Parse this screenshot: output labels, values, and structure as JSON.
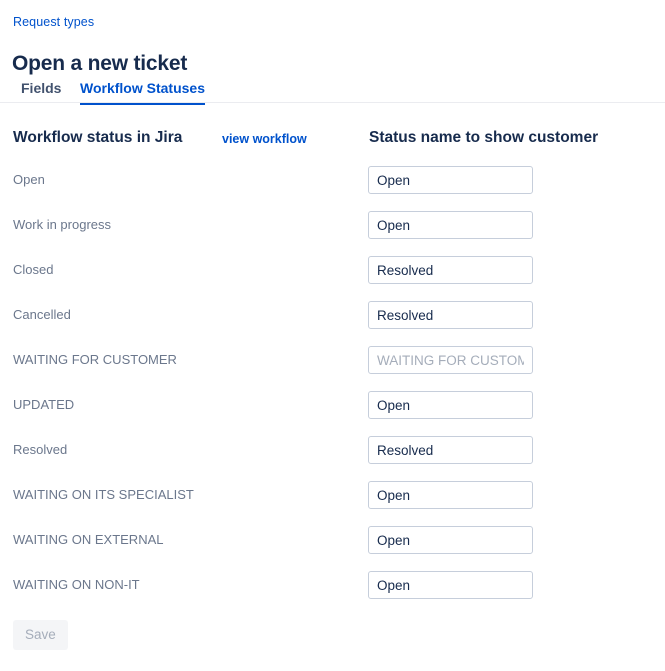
{
  "breadcrumb": {
    "label": "Request types"
  },
  "page_title": "Open a new ticket",
  "tabs": [
    {
      "label": "Fields",
      "active": false
    },
    {
      "label": "Workflow Statuses",
      "active": true
    }
  ],
  "columns": {
    "left_heading": "Workflow status in Jira",
    "right_heading": "Status name to show customer",
    "view_workflow_link": "view workflow"
  },
  "rows": [
    {
      "jira_status": "Open",
      "customer_name": "Open",
      "muted": false
    },
    {
      "jira_status": "Work in progress",
      "customer_name": "Open",
      "muted": false
    },
    {
      "jira_status": "Closed",
      "customer_name": "Resolved",
      "muted": false
    },
    {
      "jira_status": "Cancelled",
      "customer_name": "Resolved",
      "muted": false
    },
    {
      "jira_status": "WAITING FOR CUSTOMER",
      "customer_name": "WAITING FOR CUSTOMER",
      "muted": true
    },
    {
      "jira_status": "UPDATED",
      "customer_name": "Open",
      "muted": false
    },
    {
      "jira_status": "Resolved",
      "customer_name": "Resolved",
      "muted": false
    },
    {
      "jira_status": "WAITING ON ITS SPECIALIST",
      "customer_name": "Open",
      "muted": false
    },
    {
      "jira_status": "WAITING ON EXTERNAL",
      "customer_name": "Open",
      "muted": false
    },
    {
      "jira_status": "WAITING ON NON-IT",
      "customer_name": "Open",
      "muted": false
    }
  ],
  "save_button": {
    "label": "Save",
    "disabled": true
  },
  "colors": {
    "link": "#0052cc",
    "heading": "#172b4d",
    "muted_text": "#6b778c",
    "placeholder": "#a5adba",
    "field_border": "#c6cedb",
    "rule": "#ebecf0",
    "disabled_button_bg": "#f4f5f7"
  }
}
